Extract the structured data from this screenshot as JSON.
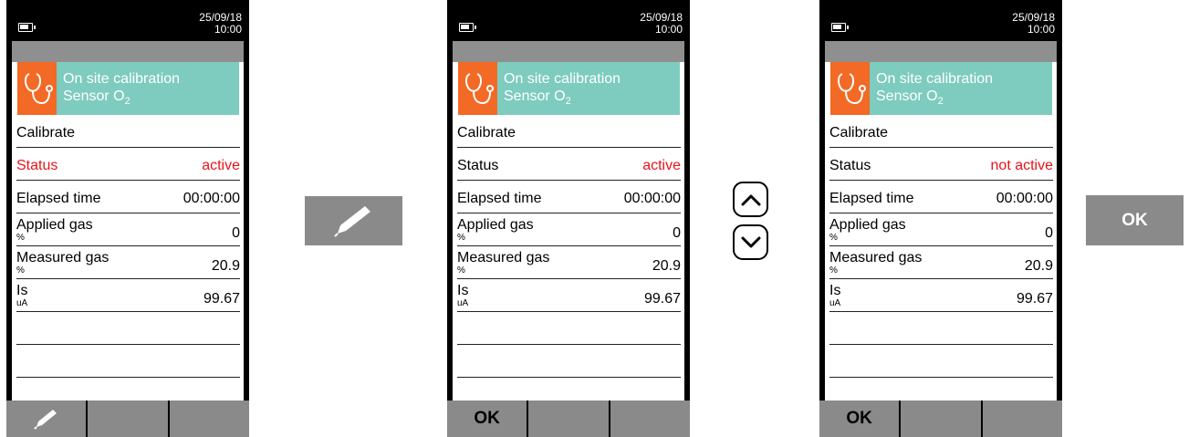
{
  "screens": [
    {
      "datetime": {
        "date": "25/09/18",
        "time": "10:00"
      },
      "header": {
        "title": "On site calibration",
        "subtitle": "Sensor O",
        "subscript": "2"
      },
      "rows": {
        "calibrate": "Calibrate",
        "status_label": "Status",
        "status_value": "active",
        "elapsed_label": "Elapsed time",
        "elapsed_value": "00:00:00",
        "applied_label": "Applied gas",
        "applied_unit": "%",
        "applied_value": "0",
        "measured_label": "Measured gas",
        "measured_unit": "%",
        "measured_value": "20.9",
        "is_label": "Is",
        "is_unit": "uA",
        "is_value": "99.67"
      },
      "softkeys": [
        "pencil-icon",
        "",
        ""
      ]
    },
    {
      "datetime": {
        "date": "25/09/18",
        "time": "10:00"
      },
      "header": {
        "title": "On site calibration",
        "subtitle": "Sensor O",
        "subscript": "2"
      },
      "rows": {
        "calibrate": "Calibrate",
        "status_label": "Status",
        "status_value": "active",
        "elapsed_label": "Elapsed time",
        "elapsed_value": "00:00:00",
        "applied_label": "Applied gas",
        "applied_unit": "%",
        "applied_value": "0",
        "measured_label": "Measured gas",
        "measured_unit": "%",
        "measured_value": "20.9",
        "is_label": "Is",
        "is_unit": "uA",
        "is_value": "99.67"
      },
      "softkeys": [
        "OK",
        "",
        ""
      ]
    },
    {
      "datetime": {
        "date": "25/09/18",
        "time": "10:00"
      },
      "header": {
        "title": "On site calibration",
        "subtitle": "Sensor O",
        "subscript": "2"
      },
      "rows": {
        "calibrate": "Calibrate",
        "status_label": "Status",
        "status_value": "not active",
        "elapsed_label": "Elapsed time",
        "elapsed_value": "00:00:00",
        "applied_label": "Applied gas",
        "applied_unit": "%",
        "applied_value": "0",
        "measured_label": "Measured gas",
        "measured_unit": "%",
        "measured_value": "20.9",
        "is_label": "Is",
        "is_unit": "uA",
        "is_value": "99.67"
      },
      "softkeys": [
        "OK",
        "",
        ""
      ]
    }
  ],
  "actions": {
    "edit_icon": "pencil-icon",
    "up_icon": "chevron-up-icon",
    "down_icon": "chevron-down-icon",
    "ok_label": "OK"
  },
  "colors": {
    "header_bg": "#7ecbbf",
    "icon_bg": "#f26a26",
    "status_red": "#e8141b",
    "softkey_bg": "#8a8a8a"
  }
}
